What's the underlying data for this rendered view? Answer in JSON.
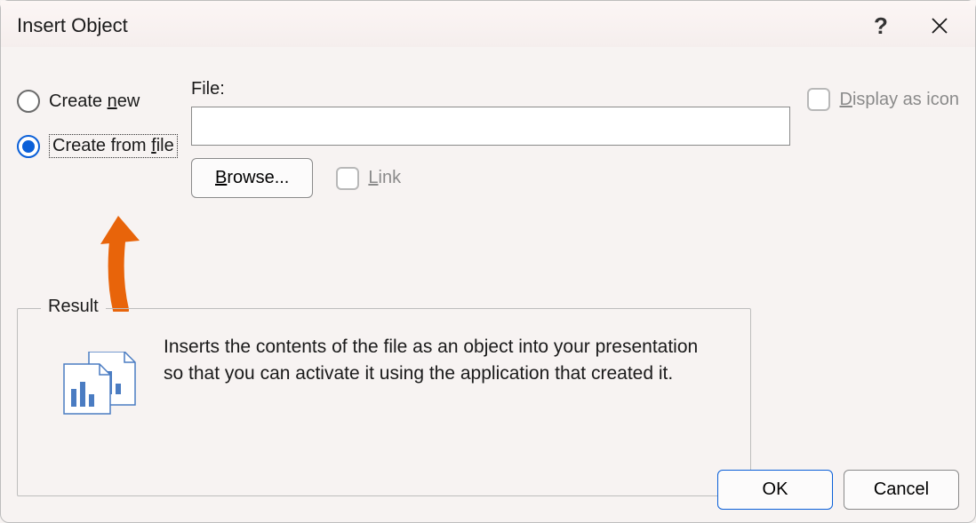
{
  "title": "Insert Object",
  "radios": {
    "create_new": "Create new",
    "create_from_file": "Create from file",
    "selected": "create_from_file"
  },
  "file": {
    "label": "File:",
    "value": "",
    "browse": "Browse..."
  },
  "link": {
    "label": "Link",
    "checked": false
  },
  "display_as_icon": {
    "label": "Display as icon",
    "checked": false
  },
  "result": {
    "legend": "Result",
    "text": "Inserts the contents of the file as an object into your presentation so that you can activate it using the application that created it."
  },
  "buttons": {
    "ok": "OK",
    "cancel": "Cancel"
  }
}
